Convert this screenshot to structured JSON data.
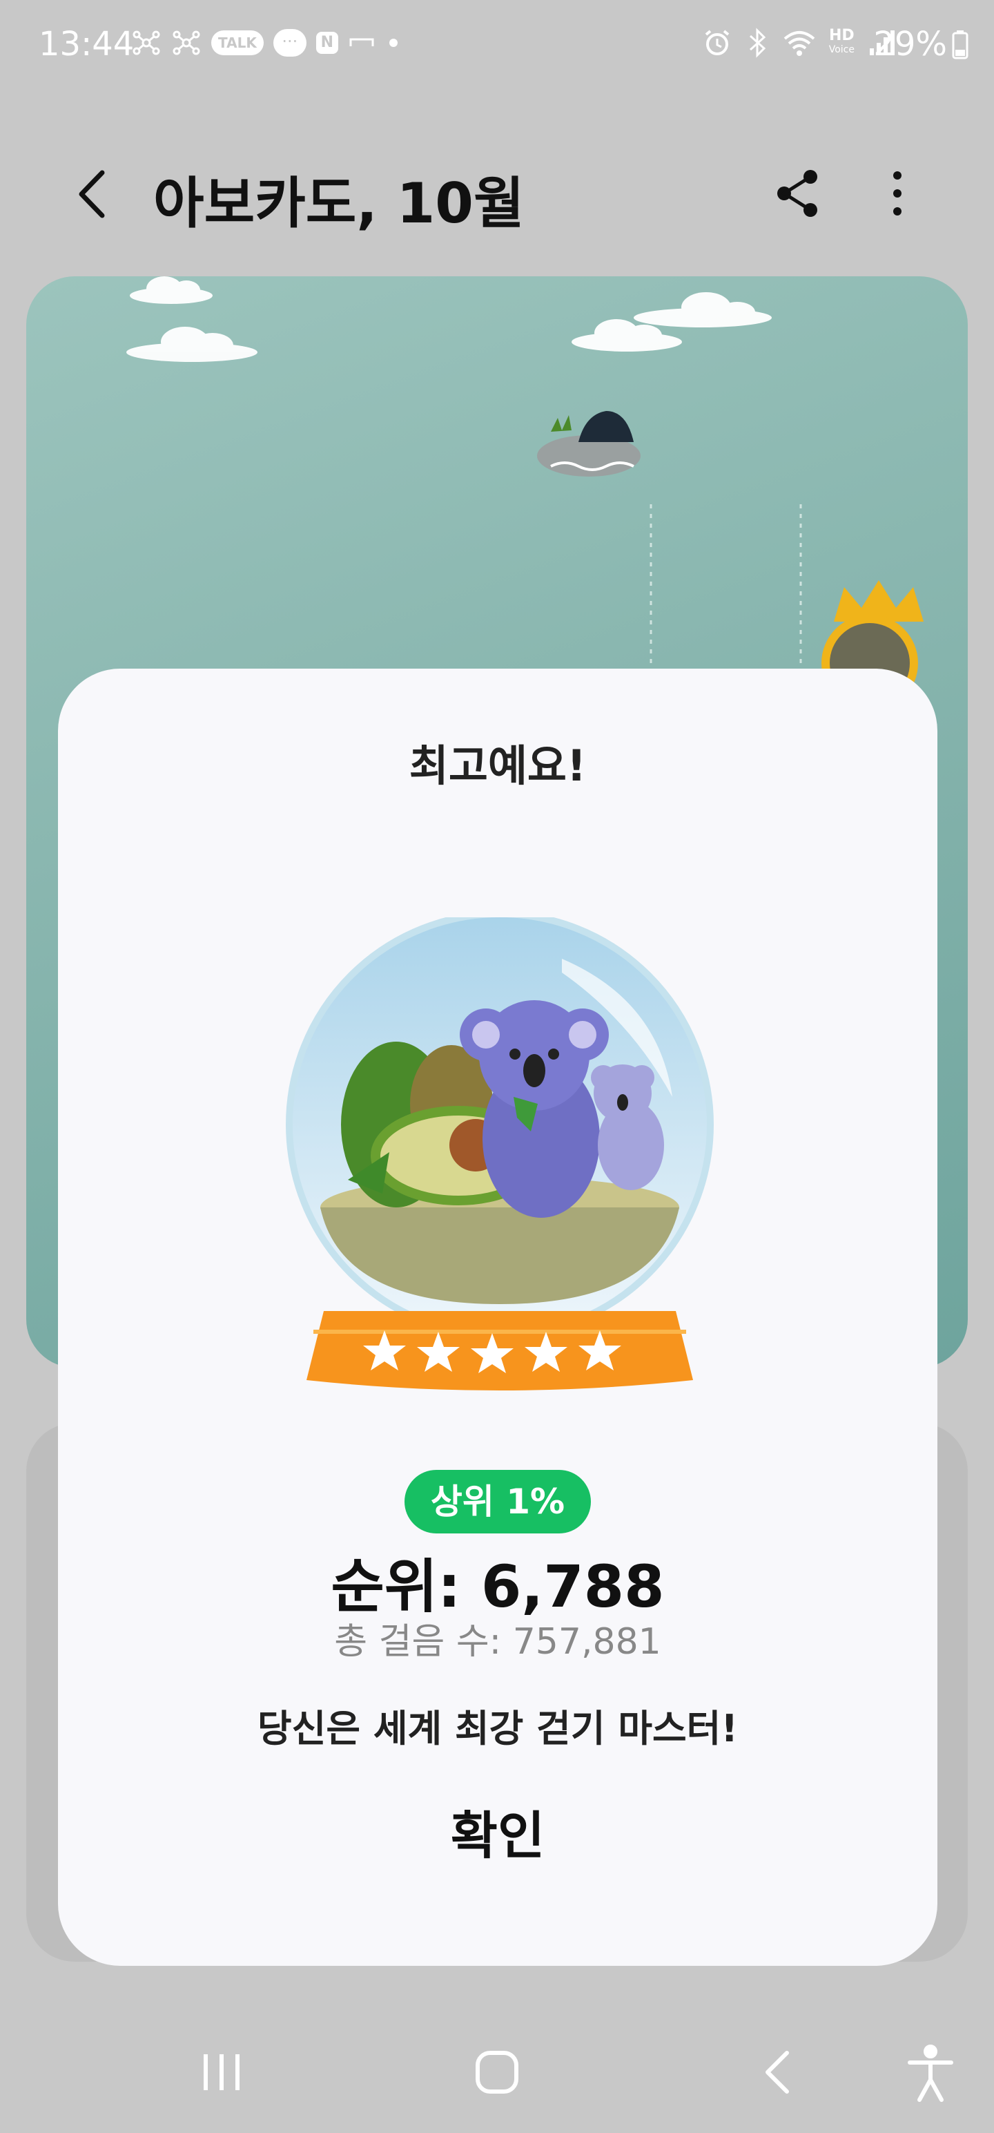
{
  "status_bar": {
    "time": "13:44",
    "talk_label": "TALK",
    "chat_label": "···",
    "n_label": "N",
    "hd_label": "HD",
    "voice_label": "Voice",
    "battery": "29%"
  },
  "app_bar": {
    "title": "아보카도, 10월"
  },
  "dialog": {
    "title": "최고예요!",
    "rank_badge": "상위 1%",
    "rank": "순위: 6,788",
    "total_steps": "총 걸음 수: 757,881",
    "message": "당신은 세계 최강 걷기 마스터!",
    "confirm_label": "확인"
  },
  "colors": {
    "badge_green": "#17bf63",
    "stand_orange": "#f7941d",
    "scene_teal": "#86b4ad"
  },
  "icons": {
    "back": "chevron-left-icon",
    "share": "share-icon",
    "more": "more-vertical-icon",
    "nav_recent": "recent-apps-icon",
    "nav_home": "home-icon",
    "nav_back": "nav-back-icon",
    "accessibility": "accessibility-icon"
  }
}
